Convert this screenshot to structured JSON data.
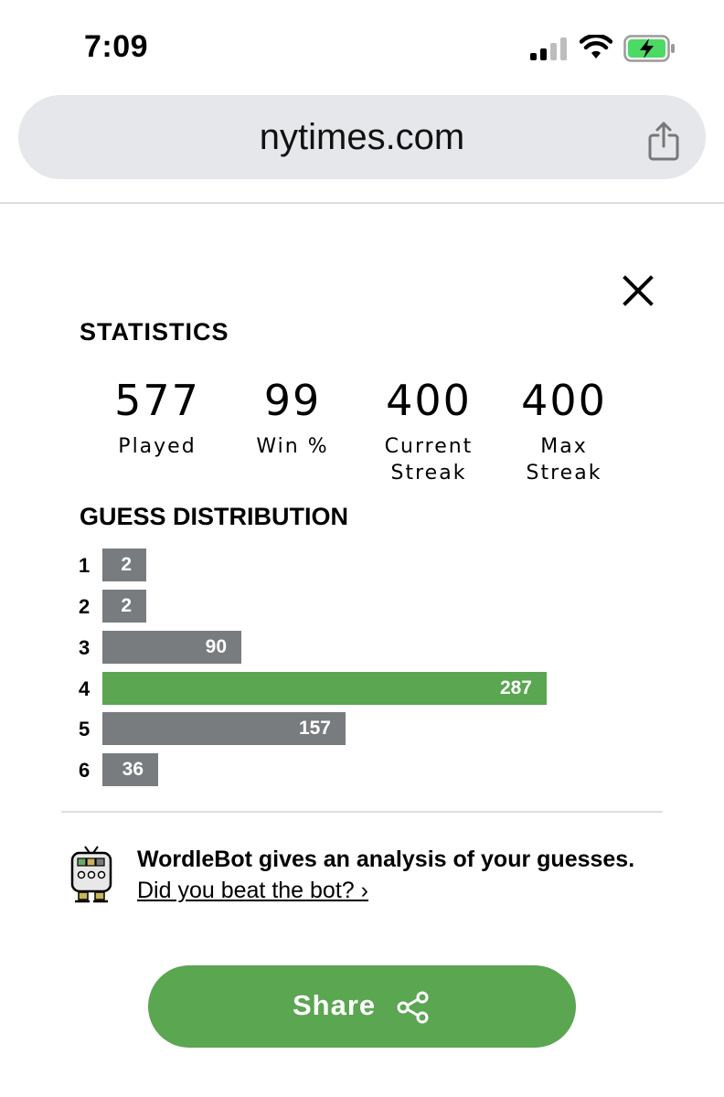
{
  "status_bar": {
    "time": "7:09",
    "icons": [
      "cellular-signal-icon",
      "wifi-icon",
      "battery-charging-icon"
    ]
  },
  "browser": {
    "url": "nytimes.com",
    "share_icon": "share-upload-icon"
  },
  "modal": {
    "close_icon": "close-icon",
    "statistics_title": "STATISTICS",
    "stats": [
      {
        "value": "577",
        "label": "Played"
      },
      {
        "value": "99",
        "label": "Win %"
      },
      {
        "value": "400",
        "label_line1": "Current",
        "label_line2": "Streak"
      },
      {
        "value": "400",
        "label_line1": "Max",
        "label_line2": "Streak"
      }
    ],
    "distribution_title": "GUESS DISTRIBUTION",
    "distribution": [
      {
        "guess": "1",
        "count": 2,
        "count_label": "2",
        "highlight": false
      },
      {
        "guess": "2",
        "count": 2,
        "count_label": "2",
        "highlight": false
      },
      {
        "guess": "3",
        "count": 90,
        "count_label": "90",
        "highlight": false
      },
      {
        "guess": "4",
        "count": 287,
        "count_label": "287",
        "highlight": true
      },
      {
        "guess": "5",
        "count": 157,
        "count_label": "157",
        "highlight": false
      },
      {
        "guess": "6",
        "count": 36,
        "count_label": "36",
        "highlight": false
      }
    ],
    "wordlebot": {
      "icon": "wordlebot-robot-icon",
      "headline": "WordleBot gives an analysis of your guesses.",
      "link": "Did you beat the bot? ›"
    },
    "share_button": {
      "label": "Share",
      "icon": "share-nodes-icon"
    }
  },
  "colors": {
    "bar_default": "#787c7e",
    "bar_highlight": "#5aa651",
    "share_button": "#5aa651",
    "url_bar": "#e5e7ea"
  }
}
